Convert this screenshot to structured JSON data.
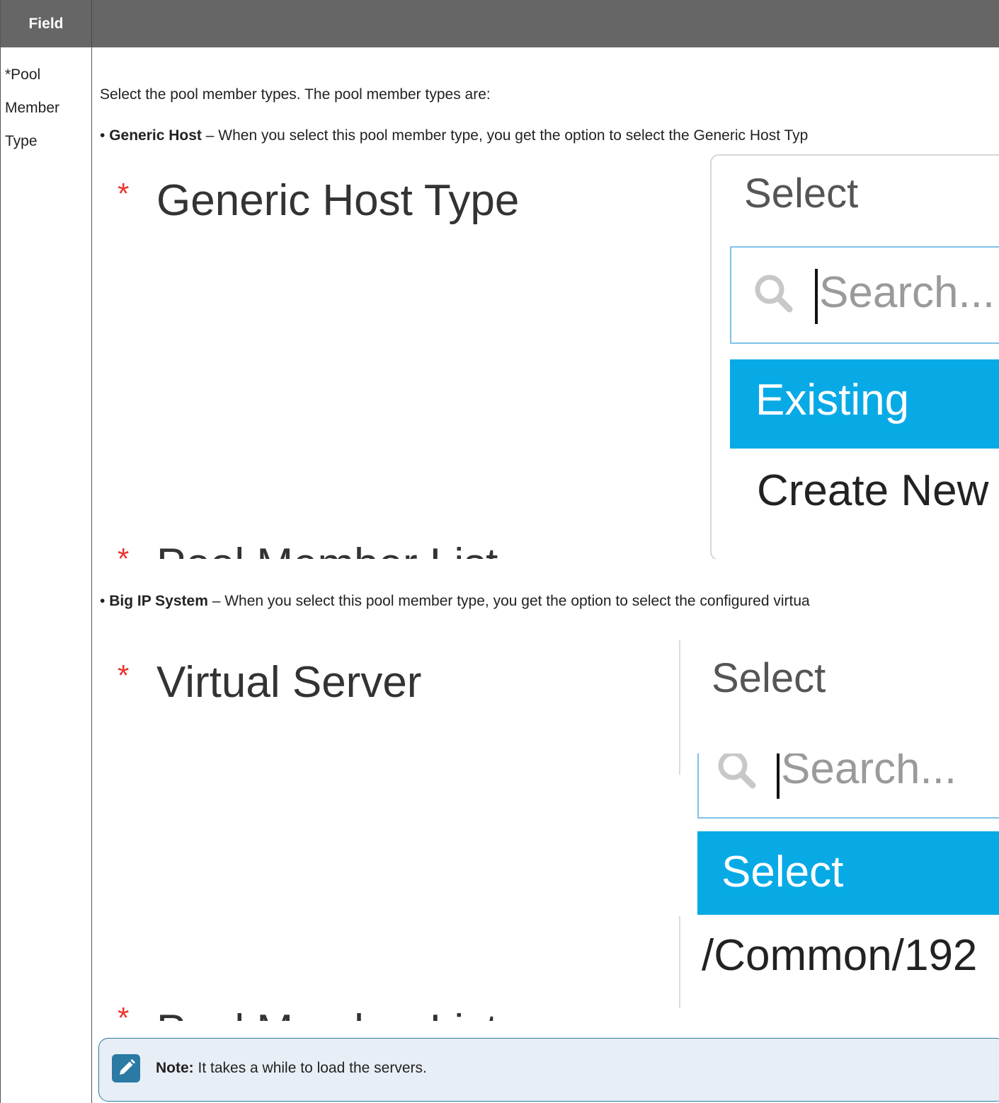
{
  "header": {
    "field_label": "Field"
  },
  "row": {
    "field_name_lines": [
      "*Pool",
      "Member",
      "Type"
    ],
    "intro": "Select the pool member types. The pool member types are:",
    "generic": {
      "bullet": "•",
      "term": "Generic Host",
      "desc": " – When you select this pool member type, you get the option to select the Generic Host Typ"
    },
    "bigip": {
      "bullet": "•",
      "term": "Big IP System",
      "desc": " – When you select this pool member type, you get the option to select the configured virtua"
    }
  },
  "shot1": {
    "required_mark": "*",
    "label": "Generic Host Type",
    "select_placeholder": "Select",
    "search_placeholder": "Search...",
    "options": [
      {
        "label": "Existing",
        "highlighted": true
      },
      {
        "label": "Create New",
        "highlighted": false
      }
    ],
    "cut_label": "Pool Member List"
  },
  "shot2": {
    "required_mark": "*",
    "label": "Virtual Server",
    "select_placeholder": "Select",
    "search_placeholder": "Search...",
    "options": [
      {
        "label": "Select",
        "highlighted": true
      },
      {
        "label": "/Common/192",
        "highlighted": false
      }
    ],
    "cut_label": "Pool Member List"
  },
  "note": {
    "prefix": "Note:",
    "text": " It takes a while to load the servers."
  },
  "colors": {
    "header_bg": "#666666",
    "highlight": "#08aae6",
    "required": "#e8352f",
    "note_border": "#2a7aa3"
  }
}
